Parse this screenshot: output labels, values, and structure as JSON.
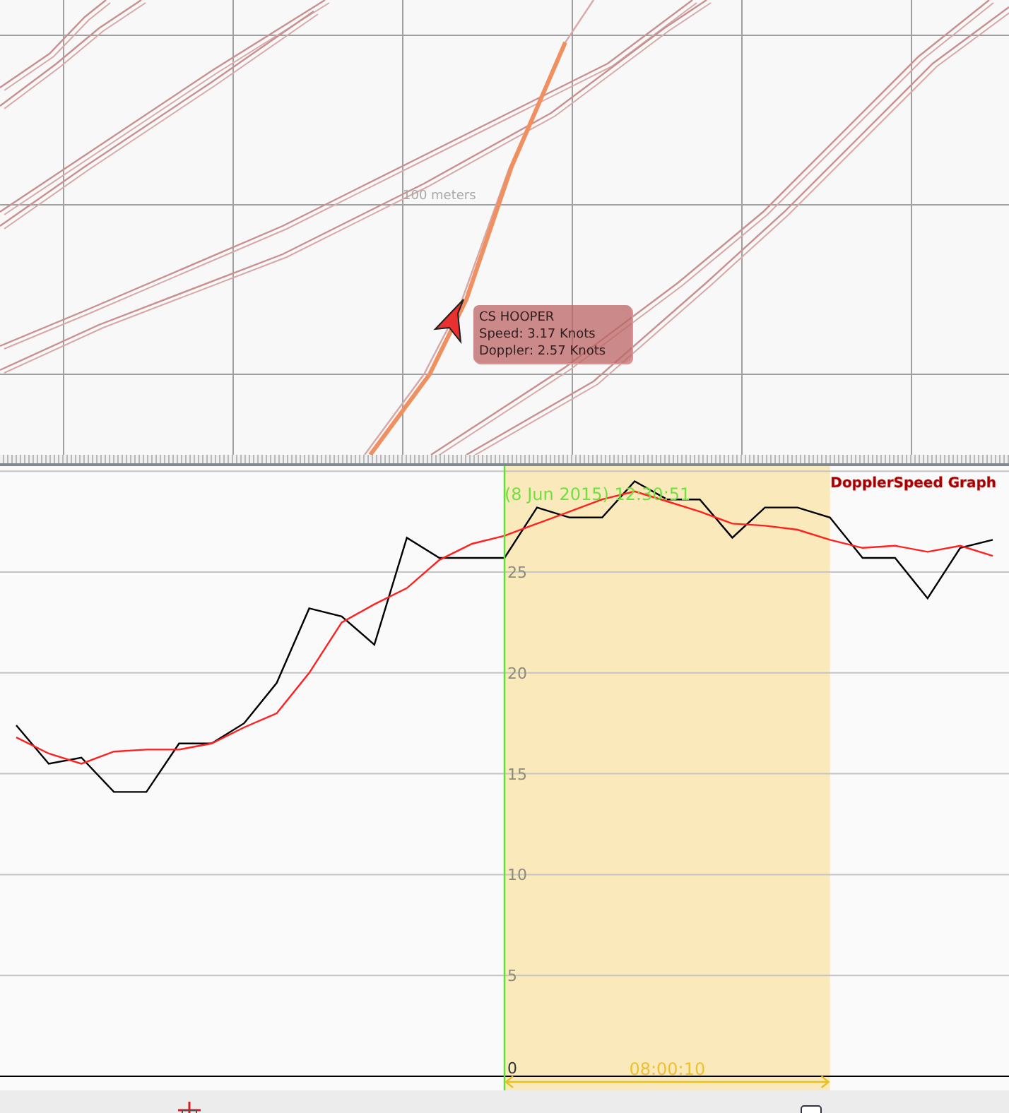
{
  "map": {
    "scale_label": "100 meters",
    "tooltip": {
      "lines": [
        "CS HOOPER",
        "Speed: 3.17 Knots",
        "Doppler: 2.57 Knots"
      ]
    }
  },
  "graph": {
    "title": "DopplerSpeed Graph",
    "cursor_label": "(8 Jun 2015) 12:30:51",
    "span_label": "08:00:10",
    "chart_data": {
      "type": "line",
      "categories": [
        null,
        null,
        null,
        null,
        null,
        null,
        null,
        null,
        null,
        null,
        null,
        null,
        null,
        null,
        null,
        null,
        null,
        null,
        null,
        null,
        null,
        null,
        null,
        null,
        null,
        null,
        null,
        null,
        null,
        null,
        null
      ],
      "ylim": [
        0,
        30
      ],
      "yticks": [
        0,
        5,
        10,
        15,
        20,
        25
      ],
      "grid": true,
      "series": [
        {
          "color": "#000000",
          "values": [
            17.4,
            15.5,
            15.8,
            14.1,
            14.1,
            16.5,
            16.5,
            17.5,
            19.5,
            23.2,
            22.8,
            21.4,
            26.7,
            25.7,
            25.7,
            25.7,
            28.2,
            27.7,
            27.7,
            29.5,
            28.6,
            28.6,
            26.7,
            28.2,
            28.2,
            27.7,
            25.7,
            25.7,
            23.7,
            26.2,
            26.6
          ]
        },
        {
          "color": "#ff2020",
          "values": [
            16.8,
            16.0,
            15.5,
            16.1,
            16.2,
            16.2,
            16.5,
            17.3,
            18.0,
            20.0,
            22.5,
            23.4,
            24.2,
            25.6,
            26.4,
            26.8,
            27.4,
            28.0,
            28.6,
            29.0,
            28.5,
            28.0,
            27.4,
            27.3,
            27.1,
            26.6,
            26.2,
            26.3,
            26.0,
            26.3,
            25.8
          ]
        }
      ]
    }
  }
}
